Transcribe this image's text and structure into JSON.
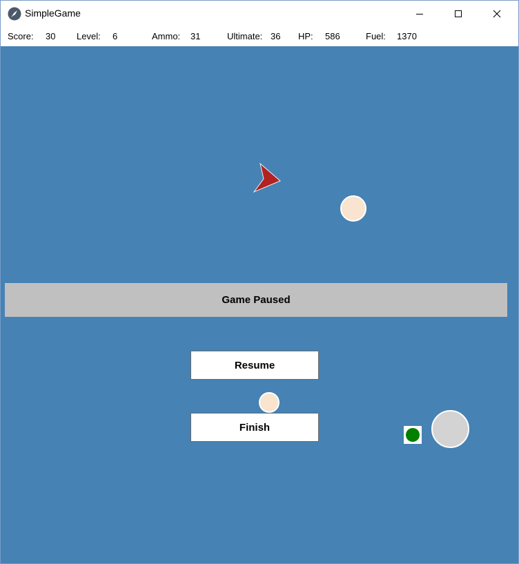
{
  "window": {
    "title": "SimpleGame",
    "app_icon": "rocket-icon"
  },
  "hud": {
    "score_label": "Score:",
    "score": "30",
    "level_label": "Level:",
    "level": "6",
    "ammo_label": "Ammo:",
    "ammo": "31",
    "ultimate_label": "Ultimate:",
    "ultimate": "36",
    "hp_label": "HP:",
    "hp": "586",
    "fuel_label": "Fuel:",
    "fuel": "1370"
  },
  "overlay": {
    "status": "Game Paused",
    "resume_label": "Resume",
    "finish_label": "Finish"
  },
  "colors": {
    "field_background": "#4682b4",
    "pause_bar": "#c0c0c0",
    "player_ship": "#b22222",
    "small_asteroid": "#f8e4cf",
    "large_asteroid": "#d3d3d3",
    "pickup": "#008000"
  }
}
